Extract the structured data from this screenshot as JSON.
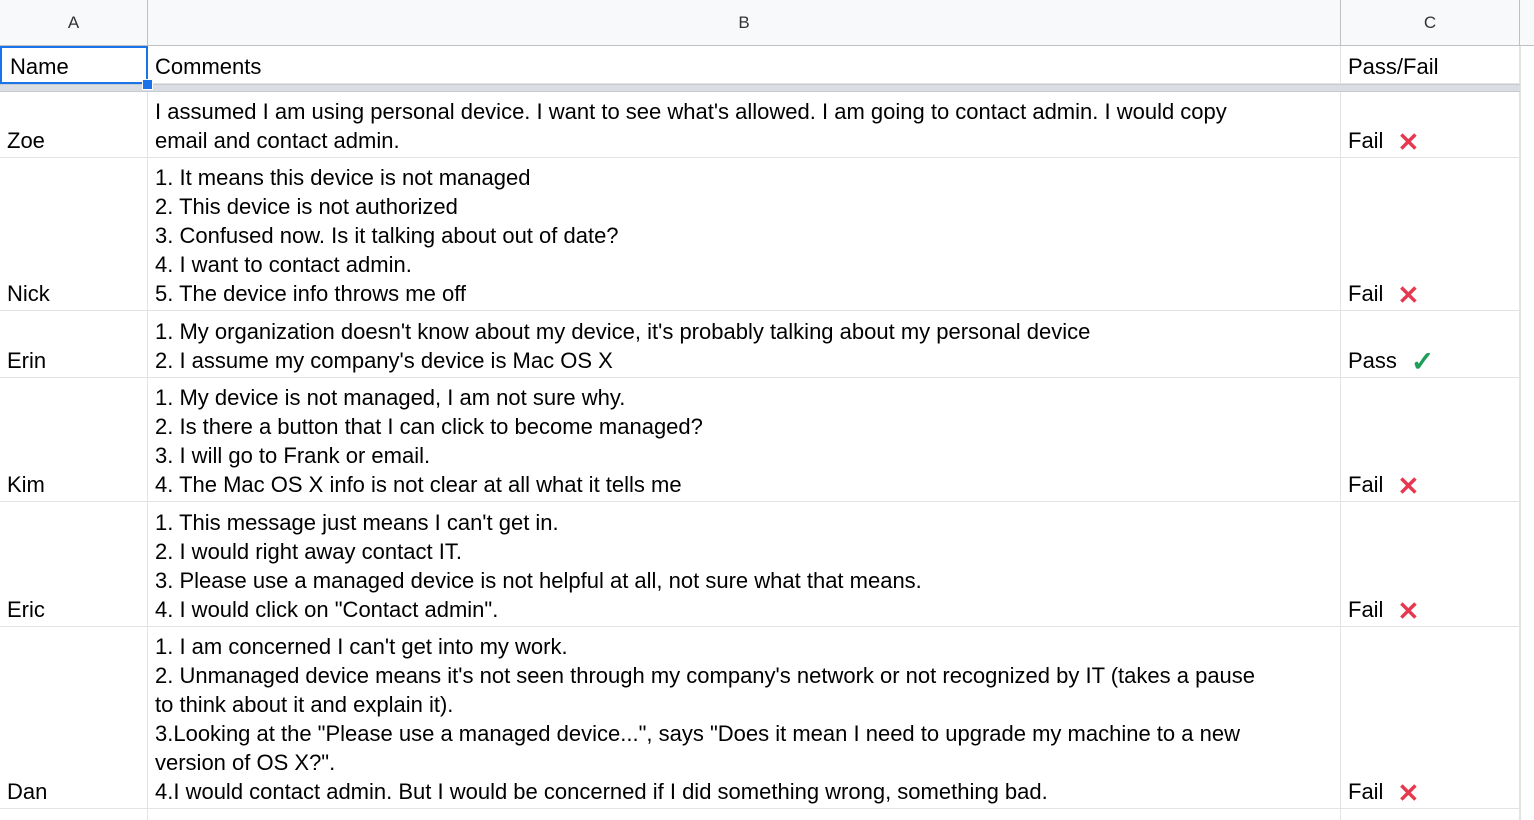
{
  "columns": [
    {
      "letter": "A"
    },
    {
      "letter": "B"
    },
    {
      "letter": "C"
    }
  ],
  "header_row": {
    "name": "Name",
    "comments": "Comments",
    "passfail": "Pass/Fail"
  },
  "rows": [
    {
      "name": "Zoe",
      "comments": "I assumed I am using personal device. I want to see what's allowed. I am going to contact admin. I would copy\nemail and contact admin.",
      "result": "Fail",
      "result_icon": "cross-icon"
    },
    {
      "name": "Nick",
      "comments": "1. It means this device is not managed\n2. This device is not authorized\n3. Confused now. Is it talking about out of date?\n4. I want to contact admin.\n5. The device info throws me off",
      "result": "Fail",
      "result_icon": "cross-icon"
    },
    {
      "name": "Erin",
      "comments": "1. My organization doesn't know about my device, it's probably talking about my personal device\n2. I assume my company's device is Mac OS X",
      "result": "Pass",
      "result_icon": "checkmark-icon"
    },
    {
      "name": "Kim",
      "comments": "1. My device is not managed, I am not sure why.\n2. Is there a button that I can click to become managed?\n3. I will go to Frank or email.\n4. The Mac OS X info is not clear at all what it tells me",
      "result": "Fail",
      "result_icon": "cross-icon"
    },
    {
      "name": "Eric",
      "comments": "1. This message just means I can't get in.\n2. I would right away contact IT.\n3. Please use a managed device is not helpful at all, not sure what that means.\n4. I would click on \"Contact admin\".",
      "result": "Fail",
      "result_icon": "cross-icon"
    },
    {
      "name": "Dan",
      "comments": "1. I am concerned I can't get into my work.\n2. Unmanaged device means it's not seen through my company's network or not recognized by IT (takes a pause\nto think about it and explain it).\n3.Looking at the \"Please use a managed device...\", says \"Does it mean I need to upgrade my machine to a new\nversion of OS X?\".\n4.I would contact admin. But I would be concerned if I did something wrong, something bad.",
      "result": "Fail",
      "result_icon": "cross-icon"
    }
  ],
  "marks": {
    "cross": "✕",
    "check": "✓"
  },
  "colors": {
    "selection": "#1a73e8",
    "fail_mark": "#e53950",
    "pass_mark": "#1e9e5a"
  }
}
